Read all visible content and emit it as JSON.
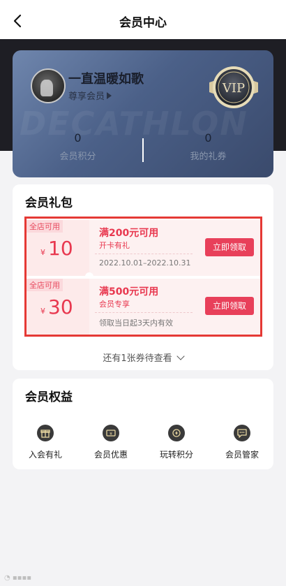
{
  "header": {
    "title": "会员中心",
    "back_icon": "chevron-left-icon"
  },
  "vip": {
    "watermark": "DECATHLON",
    "username": "一直温暖如歌",
    "level": "尊享会员",
    "badge_text": "VIP",
    "points_value": "0",
    "points_label": "会员积分",
    "coupons_value": "0",
    "coupons_label": "我的礼券"
  },
  "gift": {
    "title": "会员礼包",
    "coupons": [
      {
        "tag": "全店可用",
        "currency": "¥",
        "amount": "10",
        "condition": "满200元可用",
        "subtitle": "开卡有礼",
        "validity": "2022.10.01–2022.10.31",
        "button": "立即领取"
      },
      {
        "tag": "全店可用",
        "currency": "¥",
        "amount": "30",
        "condition": "满500元可用",
        "subtitle": "会员专享",
        "validity": "领取当日起3天内有效",
        "button": "立即领取"
      }
    ],
    "more_text": "还有1张券待查看"
  },
  "benefits": {
    "title": "会员权益",
    "items": [
      {
        "label": "入会有礼",
        "icon": "gift-icon"
      },
      {
        "label": "会员优惠",
        "icon": "voucher-icon"
      },
      {
        "label": "玩转积分",
        "icon": "points-icon"
      },
      {
        "label": "会员管家",
        "icon": "chat-icon"
      }
    ]
  },
  "colors": {
    "accent": "#e8405a",
    "highlight_border": "#e53935",
    "card": "#4b6088"
  }
}
